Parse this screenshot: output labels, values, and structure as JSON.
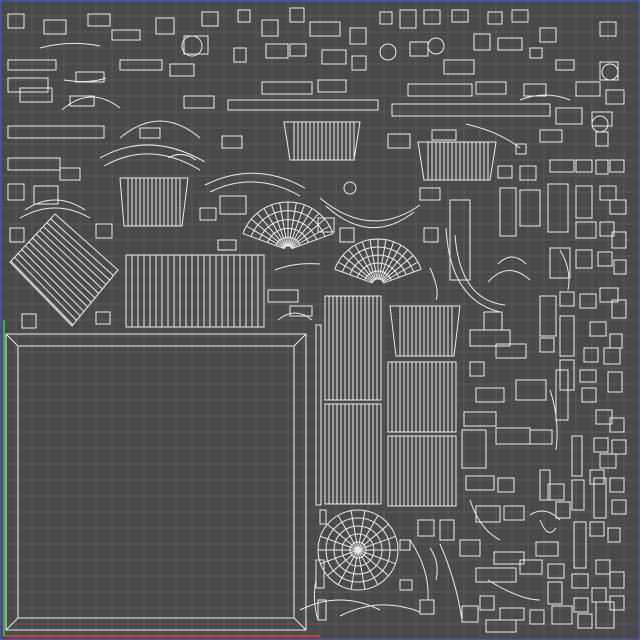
{
  "viewport": {
    "background_color": "#4a4a4a",
    "grid_color": "#5c5c5c",
    "wire_color": "#ececec",
    "axis_x_color": "#d23c3c",
    "axis_y_color": "#3cb43c",
    "border_color": "#4050c8"
  }
}
